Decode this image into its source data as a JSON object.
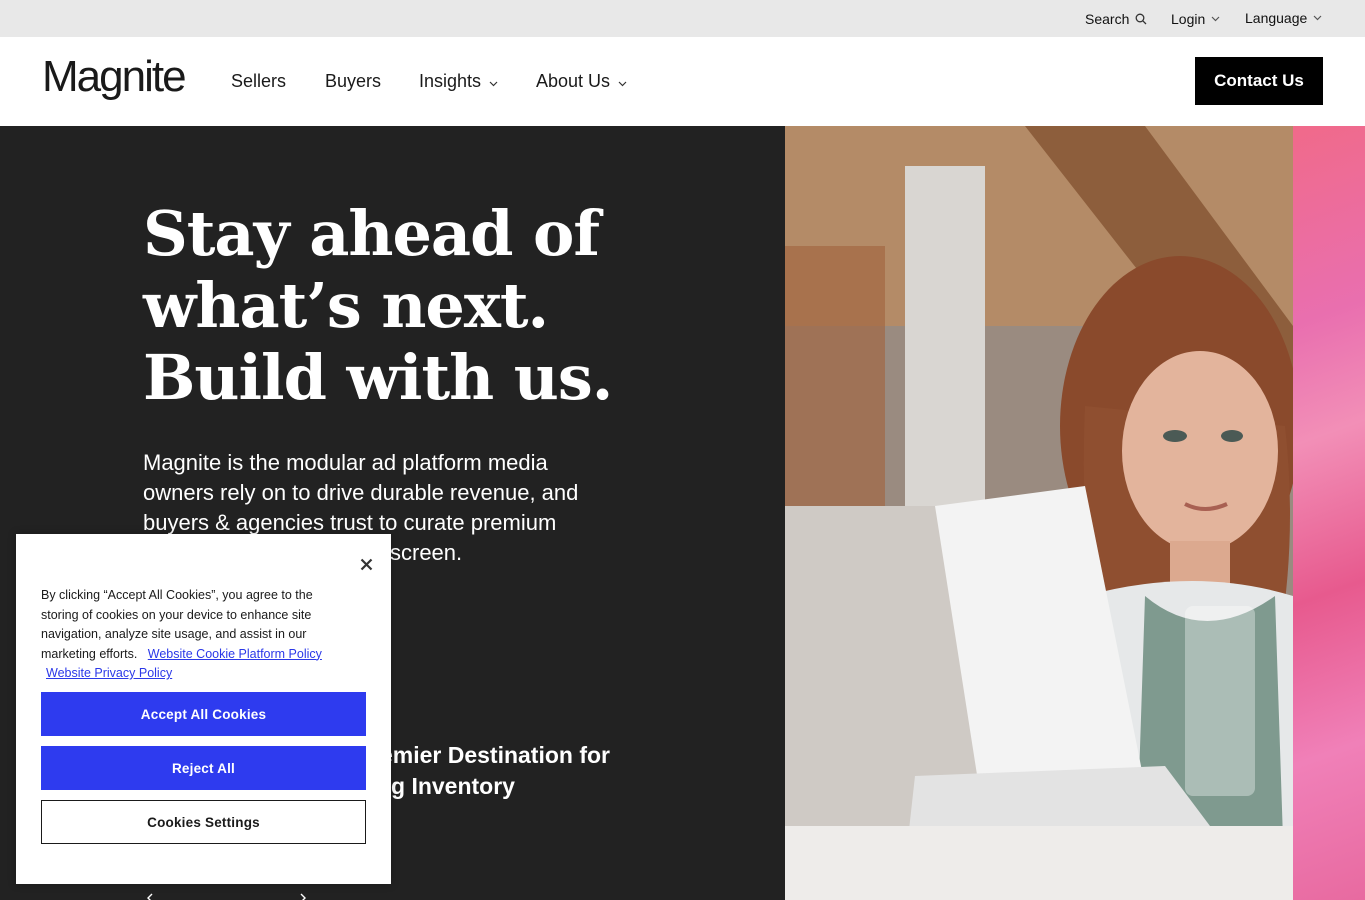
{
  "utility_bar": {
    "search_label": "Search",
    "login_label": "Login",
    "language_label": "Language"
  },
  "header": {
    "logo_text": "Magnite",
    "nav": {
      "sellers": "Sellers",
      "buyers": "Buyers",
      "insights": "Insights",
      "about": "About Us"
    },
    "contact_label": "Contact Us"
  },
  "hero": {
    "title_lines": [
      "Stay ahead of",
      "what’s next.",
      "Build with us."
    ],
    "description_lines": [
      "Magnite is the modular ad platform media",
      "owners rely on to drive durable revenue, and",
      "buyers & agencies trust to curate premium",
      "screen."
    ],
    "feature_lines": [
      "remier Destination for",
      "g Inventory"
    ]
  },
  "cookie_banner": {
    "text_lines": [
      "By clicking “Accept All Cookies”, you agree to the",
      "storing of cookies on your device to enhance site",
      "navigation, analyze site usage, and assist in our",
      "marketing efforts."
    ],
    "cookie_policy_link": "Website Cookie Platform Policy",
    "privacy_policy_link": "Website Privacy Policy",
    "accept_label": "Accept All Cookies",
    "reject_label": "Reject All",
    "settings_label": "Cookies Settings"
  },
  "colors": {
    "accent_blue": "#2e3bef",
    "hero_background": "#222222",
    "contact_button": "#000000"
  }
}
